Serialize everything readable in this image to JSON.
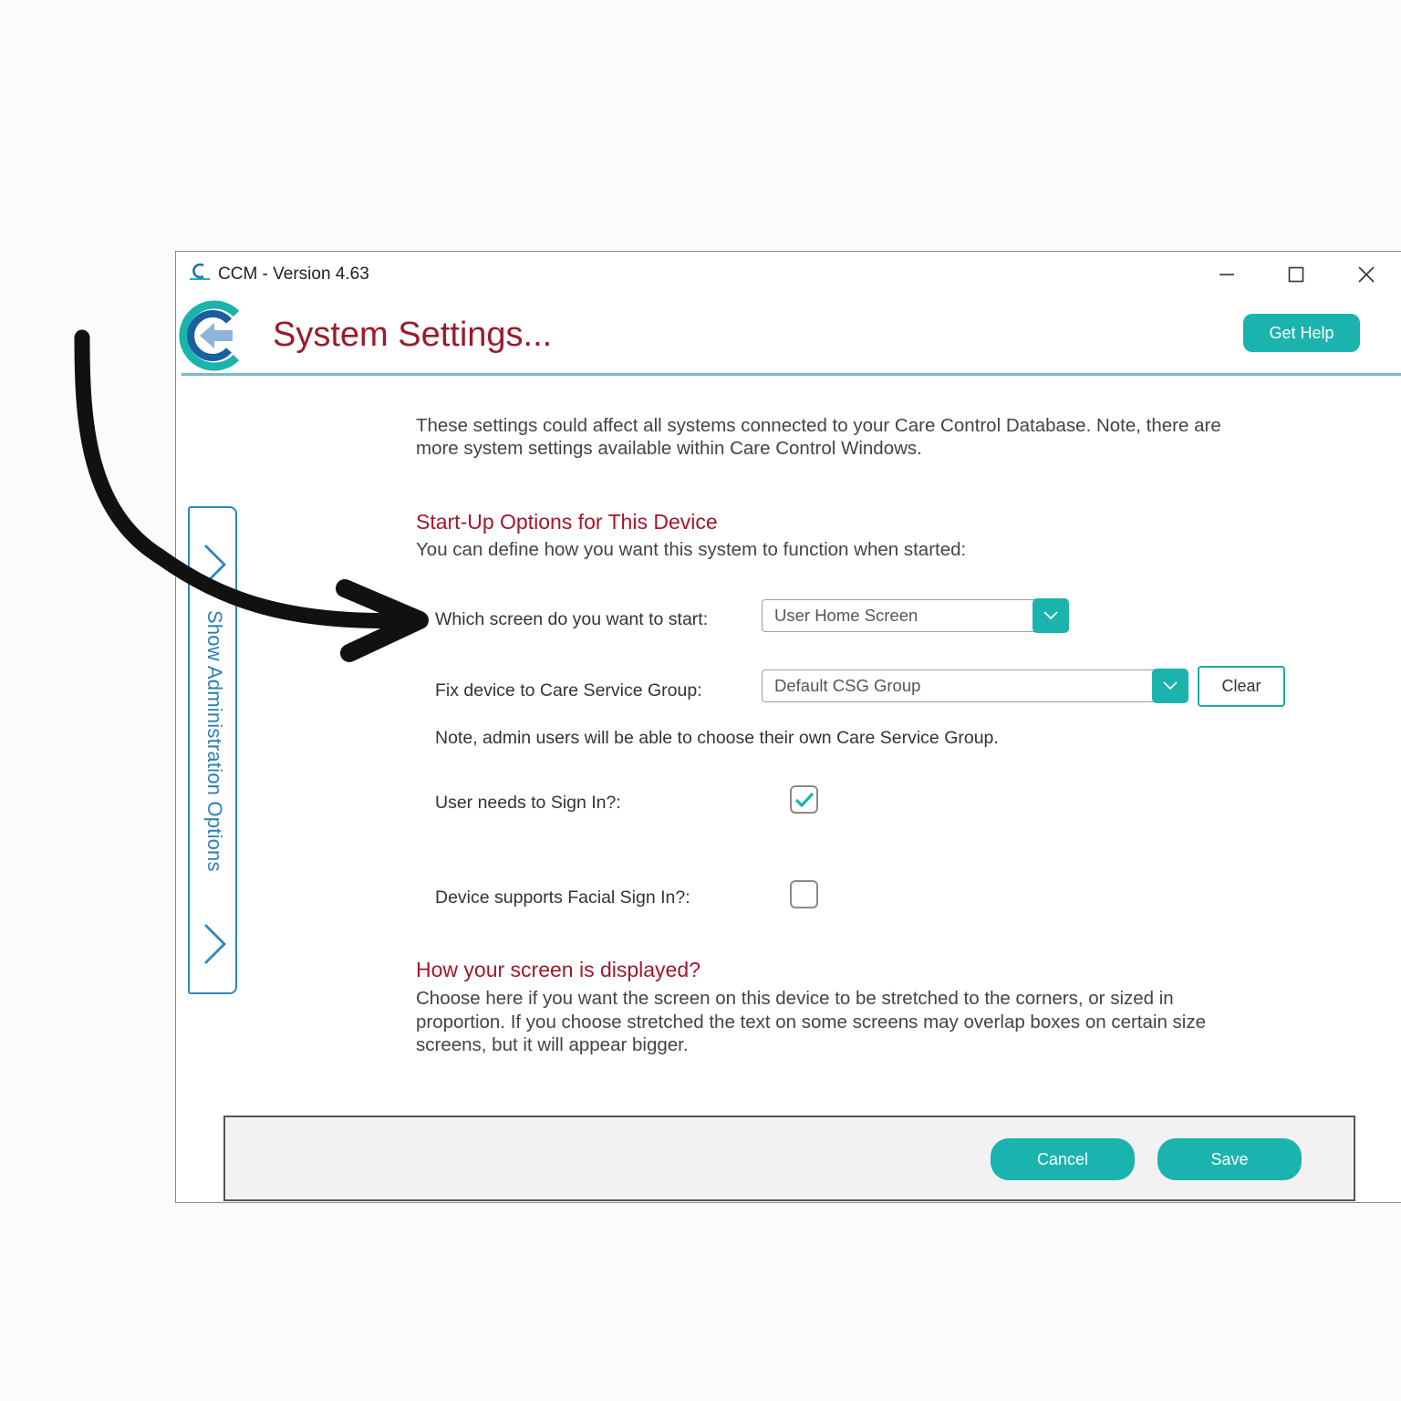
{
  "window": {
    "title": "CCM - Version 4.63"
  },
  "header": {
    "page_title": "System Settings...",
    "help_button": "Get Help"
  },
  "intro": "These settings could affect all systems connected to your Care Control Database.  Note, there are more system settings available within Care Control Windows.",
  "side_panel": {
    "label": "Show Administration Options"
  },
  "startup": {
    "title": "Start-Up Options for This Device",
    "subtitle": "You can define how you want this system to function when started:",
    "start_screen_label": "Which screen do you want to start:",
    "start_screen_value": "User Home Screen",
    "csg_label": "Fix device to Care Service Group:",
    "csg_value": "Default CSG Group",
    "clear_button": "Clear",
    "csg_note": "Note, admin users will be able to choose their own Care Service Group.",
    "sign_in_label": "User needs to Sign In?:",
    "sign_in_checked": true,
    "facial_label": "Device supports Facial Sign In?:",
    "facial_checked": false
  },
  "display": {
    "title": "How your screen is displayed?",
    "description": "Choose here if you want the screen on this device to be stretched to the corners, or sized in proportion.  If you choose stretched the text on some screens may overlap boxes on certain size screens, but it will appear bigger."
  },
  "footer": {
    "cancel_button": "Cancel",
    "save_button": "Save"
  },
  "colors": {
    "accent_teal": "#1bb3ad",
    "title_red": "#9a1b2c",
    "panel_blue": "#2c88c0"
  }
}
